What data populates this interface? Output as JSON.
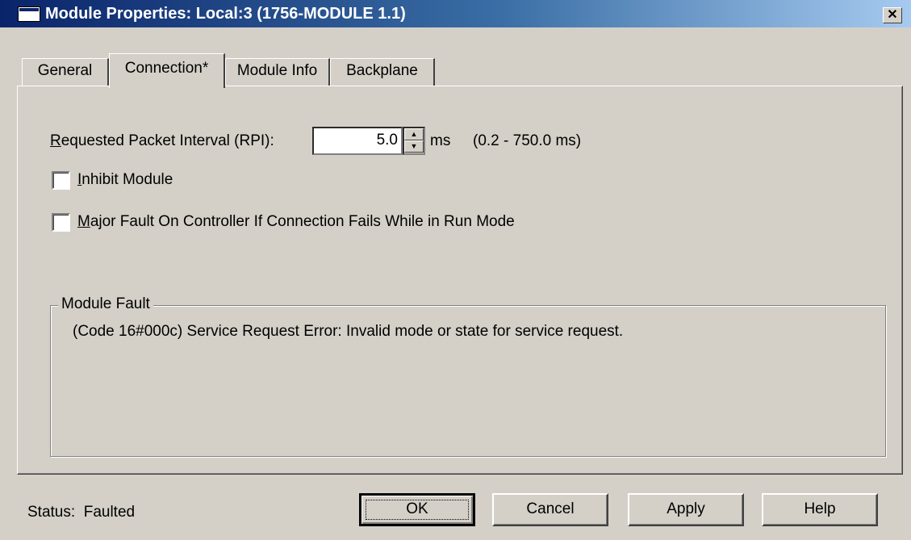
{
  "window": {
    "title": "Module Properties: Local:3 (1756-MODULE 1.1)",
    "close_label": "✕"
  },
  "tabs": [
    {
      "label": "General"
    },
    {
      "label": "Connection*"
    },
    {
      "label": "Module Info"
    },
    {
      "label": "Backplane"
    }
  ],
  "connection": {
    "rpi_label_mnemonic": "R",
    "rpi_label_rest": "equested Packet Interval (RPI):",
    "rpi_value": "5.0",
    "rpi_unit": "ms",
    "rpi_range": "(0.2 - 750.0 ms)",
    "inhibit_mnemonic": "I",
    "inhibit_rest": "nhibit Module",
    "inhibit_checked": false,
    "major_fault_mnemonic": "M",
    "major_fault_rest": "ajor Fault On Controller If Connection Fails While in Run Mode",
    "major_fault_checked": false
  },
  "module_fault": {
    "legend": "Module Fault",
    "message": "(Code 16#000c) Service Request Error: Invalid mode or state for service request."
  },
  "status": {
    "label": "Status:",
    "value": "Faulted"
  },
  "buttons": {
    "ok": "OK",
    "cancel": "Cancel",
    "apply": "Apply",
    "help": "Help"
  }
}
